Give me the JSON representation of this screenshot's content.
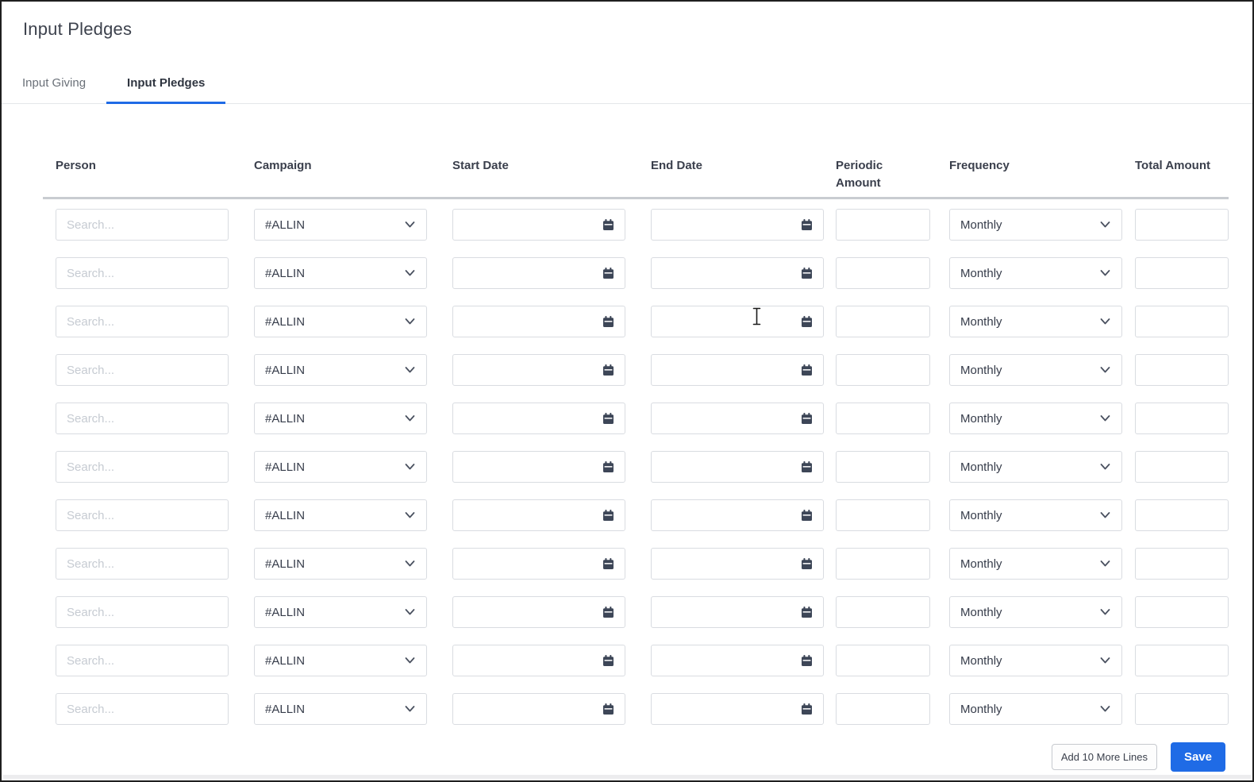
{
  "colors": {
    "accent_blue": "#1f6be6",
    "text_dark": "#3a4050",
    "text_muted": "#6a7078",
    "placeholder": "#c6cbd2",
    "input_border": "#d9dce1",
    "header_divider": "#c9ccd1"
  },
  "header": {
    "title": "Input Pledges"
  },
  "tabs": {
    "items": [
      {
        "label": "Input Giving",
        "active": false
      },
      {
        "label": "Input Pledges",
        "active": true
      }
    ]
  },
  "grid": {
    "columns": {
      "person": "Person",
      "campaign": "Campaign",
      "start_date": "Start Date",
      "end_date": "End Date",
      "periodic_amount": "Periodic Amount",
      "frequency": "Frequency",
      "total_amount": "Total Amount"
    },
    "rows_count": 11,
    "defaults": {
      "person_placeholder": "Search...",
      "person_value": "",
      "campaign_selected": "#ALLIN",
      "start_date_value": "",
      "end_date_value": "",
      "periodic_amount_value": "",
      "frequency_selected": "Monthly",
      "total_amount_value": ""
    }
  },
  "icons": {
    "calendar": "calendar-icon",
    "chevron": "chevron-down-icon"
  },
  "footer": {
    "add_more_label": "Add 10 More Lines",
    "save_label": "Save"
  }
}
